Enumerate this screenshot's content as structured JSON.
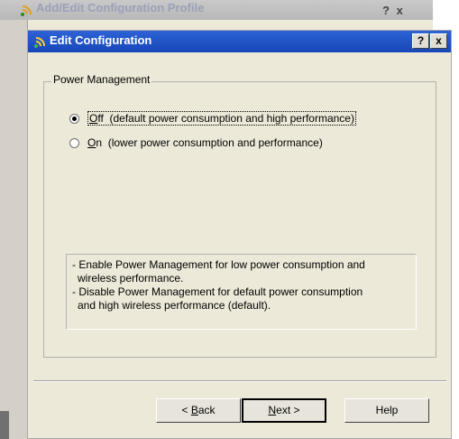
{
  "background_window": {
    "title": "Add/Edit Configuration Profile",
    "help_label": "?",
    "close_label": "x"
  },
  "dialog": {
    "title": "Edit Configuration",
    "help_label": "?",
    "close_label": "x"
  },
  "power_management": {
    "group_label": "Power Management",
    "options": [
      {
        "key": "O",
        "rest": "ff",
        "description": "(default power consumption and high performance)",
        "selected": true
      },
      {
        "key": "O",
        "rest": "n",
        "description": "(lower power consumption and performance)",
        "selected": false
      }
    ],
    "info_lines": [
      "- Enable Power Management for low power consumption and",
      "  wireless performance.",
      "- Disable Power Management for default power consumption",
      "  and high wireless performance (default)."
    ]
  },
  "buttons": {
    "back_prefix": "< ",
    "back_key": "B",
    "back_rest": "ack",
    "next_key": "N",
    "next_rest": "ext >",
    "help": "Help"
  },
  "colors": {
    "title_bar": "#1846b8",
    "dialog_face": "#ece9d8"
  }
}
